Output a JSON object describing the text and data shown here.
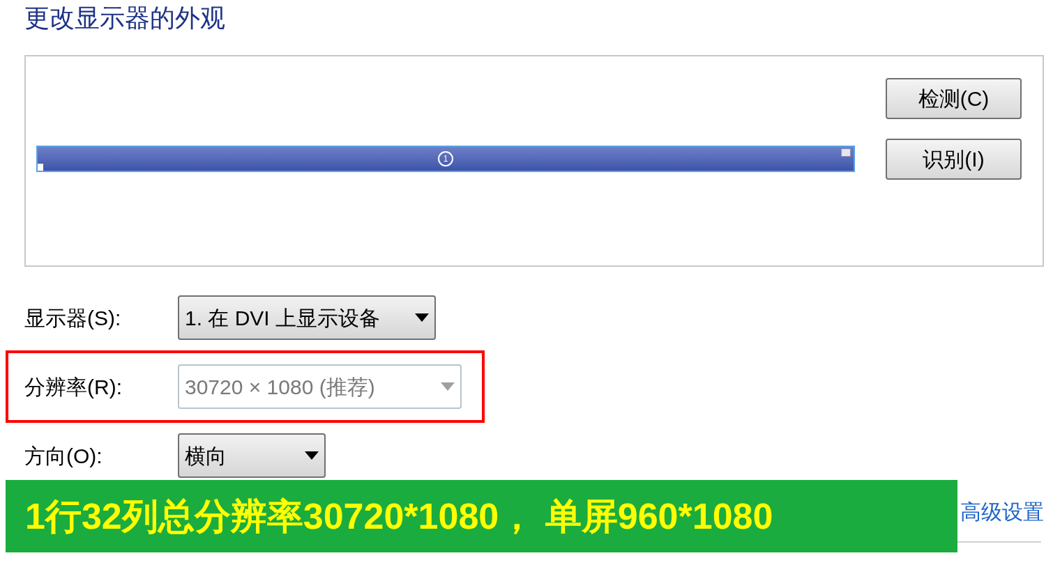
{
  "title": "更改显示器的外观",
  "preview": {
    "monitor_number": "1",
    "buttons": [
      "检测(C)",
      "识别(I)"
    ]
  },
  "settings": [
    {
      "label": "显示器(S):",
      "value": "1. 在 DVI 上显示设备",
      "disabled": false,
      "highlighted": false
    },
    {
      "label": "分辨率(R):",
      "value": "30720 × 1080 (推荐)",
      "disabled": true,
      "highlighted": true
    },
    {
      "label": "方向(O):",
      "value": "横向",
      "disabled": false,
      "highlighted": false
    }
  ],
  "banner": "1行32列总分辨率30720*1080， 单屏960*1080",
  "advanced_link": "高级设置"
}
